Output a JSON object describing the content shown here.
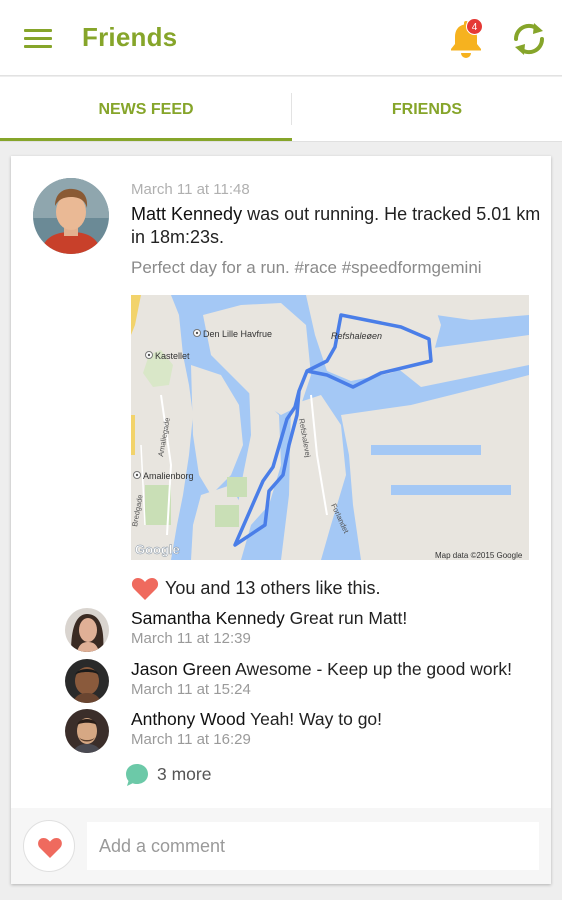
{
  "app_bar": {
    "title": "Friends",
    "notification_count": "4",
    "accent_color": "#86a52a"
  },
  "tabs": [
    {
      "label": "NEWS FEED",
      "selected": true
    },
    {
      "label": "FRIENDS",
      "selected": false
    }
  ],
  "post": {
    "timestamp": "March 11 at 11:48",
    "author": "Matt Kennedy",
    "activity_text": " was out running. He tracked 5.01 km in 18m:23s.",
    "caption": "Perfect day for a run. #race #speedformgemini",
    "map": {
      "labels": {
        "refshaleoen": "Refshaleøen",
        "den_lille_havfrue": "Den Lille Havfrue",
        "kastellet": "Kastellet",
        "amalienborg": "Amalienborg",
        "amaliegade": "Amaliegade",
        "bredgade": "Bredgade",
        "refshalevej": "Refshalevej",
        "forlandet": "Forlandet",
        "copyright": "Map data ©2015 Google",
        "logo": "Google"
      },
      "route_color": "#4a7ee8",
      "water_color": "#a4c8f5",
      "land_color": "#e8e5df"
    },
    "likes_text": "You and 13 others like this.",
    "comments": [
      {
        "name": "Samantha Kennedy",
        "text": " Great run Matt!",
        "time": "March 11 at 12:39"
      },
      {
        "name": "Jason Green",
        "text": " Awesome - Keep up the good work!",
        "time": "March 11 at 15:24"
      },
      {
        "name": "Anthony Wood",
        "text": " Yeah! Way to go!",
        "time": "March 11 at 16:29"
      }
    ],
    "more_comments": "3 more",
    "comment_placeholder": "Add a comment"
  }
}
